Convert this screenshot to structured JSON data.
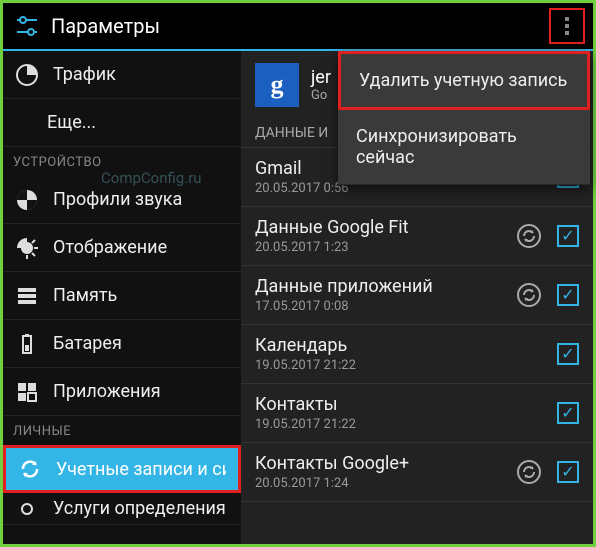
{
  "header": {
    "title": "Параметры"
  },
  "watermark": "CompConfig.ru",
  "sidebar": {
    "traffic": "Трафик",
    "more": "Еще...",
    "section_device": "УСТРОЙСТВО",
    "profiles": "Профили звука",
    "display": "Отображение",
    "memory": "Память",
    "battery": "Батарея",
    "apps": "Приложения",
    "section_personal": "ЛИЧНЫЕ",
    "accounts": "Учетные записи и син",
    "services": "Услуги определения"
  },
  "account": {
    "name": "jer",
    "sub": "Go",
    "data_header": "ДАННЫЕ И"
  },
  "sync_items": [
    {
      "title": "Gmail",
      "time": "20.05.2017 0:56",
      "syncing": false,
      "checked": true
    },
    {
      "title": "Данные Google Fit",
      "time": "20.05.2017 1:23",
      "syncing": true,
      "checked": true
    },
    {
      "title": "Данные приложений",
      "time": "17.05.2017 0:08",
      "syncing": true,
      "checked": true
    },
    {
      "title": "Календарь",
      "time": "19.05.2017 21:22",
      "syncing": false,
      "checked": true
    },
    {
      "title": "Контакты",
      "time": "19.05.2017 21:22",
      "syncing": false,
      "checked": true
    },
    {
      "title": "Контакты Google+",
      "time": "20.05.2017 1:24",
      "syncing": true,
      "checked": true
    }
  ],
  "popup": {
    "delete": "Удалить учетную запись",
    "sync_now": "Синхронизировать сейчас"
  }
}
